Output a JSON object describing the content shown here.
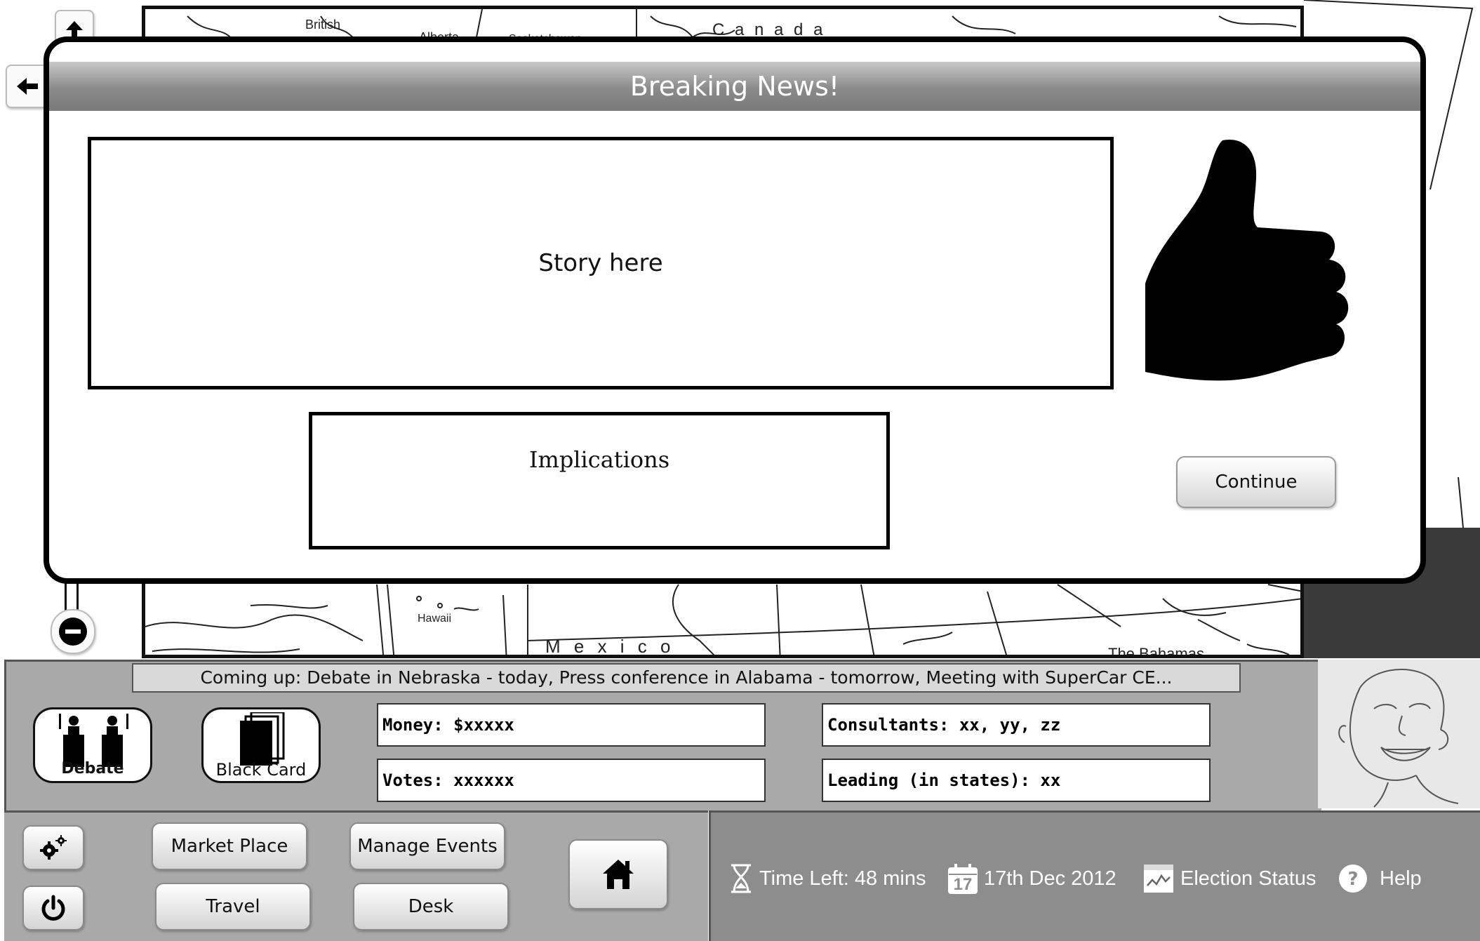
{
  "map": {
    "labels": {
      "british_columbia": "British",
      "alberta": "Alberta",
      "saskatchewan": "Saskatchewan",
      "canada": "C a n a d a",
      "hawaii": "Hawaii",
      "mexico": "M e x i c o",
      "bahamas": "The Bahamas"
    }
  },
  "modal": {
    "title": "Breaking News!",
    "story_placeholder": "Story here",
    "implications_placeholder": "Implications",
    "continue_label": "Continue"
  },
  "ticker": {
    "text": "Coming up: Debate in Nebraska - today, Press conference in Alabama - tomorrow, Meeting with SuperCar CE..."
  },
  "actions": {
    "debate_label": "Debate",
    "black_card_label": "Black Card"
  },
  "info": {
    "money": "Money: $xxxxx",
    "votes": "Votes: xxxxxx",
    "consultants": "Consultants: xx, yy, zz",
    "leading": "Leading (in states): xx"
  },
  "bottom": {
    "market_place": "Market Place",
    "manage_events": "Manage Events",
    "travel": "Travel",
    "desk": "Desk"
  },
  "status": {
    "time_left": "Time Left: 48 mins",
    "date": "17th Dec 2012",
    "calendar_day": "17",
    "election_status": "Election Status",
    "help": "Help"
  },
  "icons": {
    "settings": "gears-icon",
    "power": "power-icon",
    "home": "home-icon",
    "hourglass": "hourglass-icon",
    "calendar": "calendar-icon",
    "chart": "chart-icon",
    "help": "help-icon",
    "thumb": "thumbs-up-icon"
  }
}
